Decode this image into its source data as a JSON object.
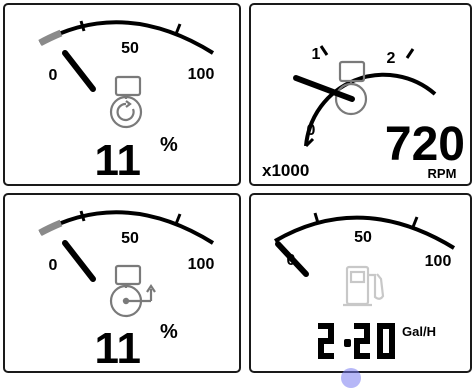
{
  "gauges": [
    {
      "id": "engine-load",
      "tick_labels": [
        "0",
        "50",
        "100"
      ],
      "value": "11",
      "unit": "%",
      "fraction": 0.11,
      "icon": "engine-load-icon"
    },
    {
      "id": "rpm",
      "tick_labels": [
        "0",
        "1",
        "2"
      ],
      "multiplier": "x1000",
      "value": "720",
      "unit": "RPM",
      "fraction": 0.24,
      "icon": "engine-icon"
    },
    {
      "id": "engine-output",
      "tick_labels": [
        "0",
        "50",
        "100"
      ],
      "value": "11",
      "unit": "%",
      "fraction": 0.11,
      "icon": "engine-output-icon"
    },
    {
      "id": "fuel-rate",
      "tick_labels": [
        "0",
        "50",
        "100"
      ],
      "value": "2.20",
      "unit": "Gal/H",
      "fraction": 0.022,
      "icon": "fuel-pump-icon"
    }
  ],
  "colors": {
    "needle": "#000000",
    "filled_arc": "#8a8a8a",
    "icon": "#7a7a7a",
    "fuel_icon": "#c8c8c8",
    "accent_dot": "#7a7cf0"
  }
}
